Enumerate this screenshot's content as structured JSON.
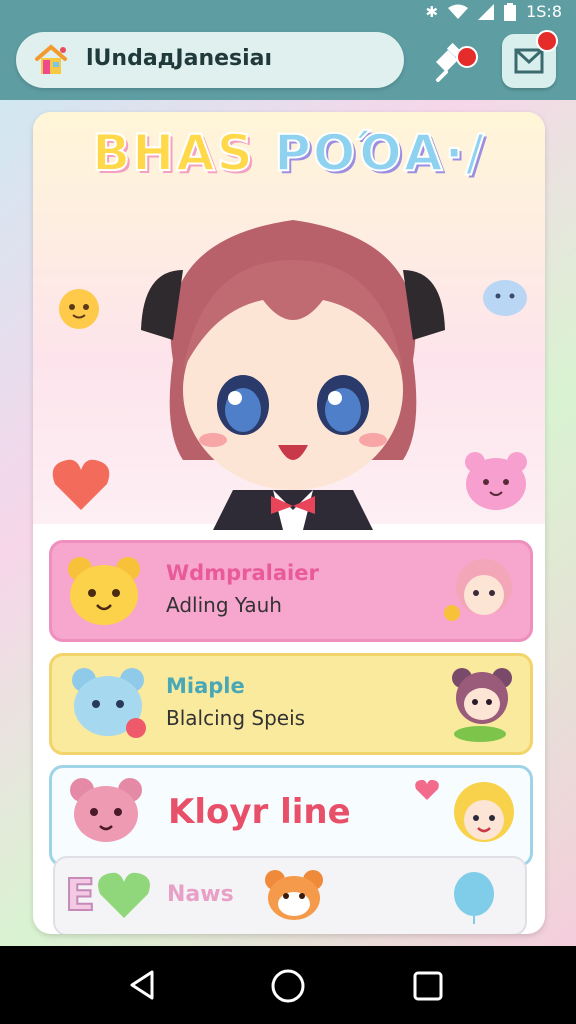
{
  "status_bar": {
    "time": "1S:8"
  },
  "top_bar": {
    "search_text": "lUndaдJanesiaı",
    "icons": [
      "home-icon",
      "pin-icon",
      "message-icon"
    ]
  },
  "hero": {
    "title_part1": "BHAS",
    "title_part2": "POΌA·/"
  },
  "menu": {
    "item1": {
      "title": "Wdmpralaier",
      "subtitle": "Adling Yauh"
    },
    "item2": {
      "title": "Miaple",
      "subtitle": "Blalcing Spеis"
    },
    "item3": {
      "title": "Kloyr line"
    },
    "item4": {
      "prefix": "E",
      "label": "Naws"
    }
  },
  "colors": {
    "accent": "#5e9ea3",
    "pink": "#f7a6cd",
    "yellow": "#faea9e",
    "blue": "#9fd3e6"
  }
}
